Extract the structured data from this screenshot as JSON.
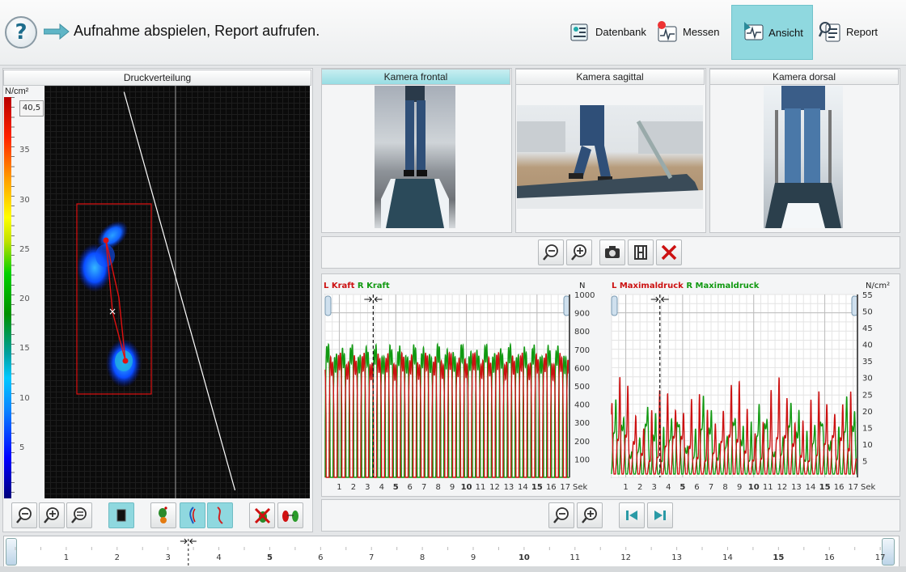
{
  "header": {
    "help_icon": "?",
    "instruction": "Aufnahme abspielen, Report aufrufen.",
    "nav": [
      {
        "label": "Datenbank",
        "icon": "database-icon"
      },
      {
        "label": "Messen",
        "icon": "measure-icon"
      },
      {
        "label": "Ansicht",
        "icon": "view-icon",
        "active": true
      },
      {
        "label": "Report",
        "icon": "report-icon"
      }
    ]
  },
  "pressure": {
    "title": "Druckverteilung",
    "unit": "N/cm²",
    "max_value": "40,5",
    "scale_labels": [
      "35",
      "30",
      "25",
      "20",
      "15",
      "10",
      "5"
    ]
  },
  "cameras": [
    {
      "title": "Kamera frontal",
      "selected": true
    },
    {
      "title": "Kamera sagittal",
      "selected": false
    },
    {
      "title": "Kamera dorsal",
      "selected": false
    }
  ],
  "charts_labels": {
    "force_left": "L Kraft",
    "force_right": "R Kraft",
    "force_unit": "N",
    "pressure_left": "L Maximaldruck",
    "pressure_right": "R Maximaldruck",
    "pressure_unit": "N/cm²",
    "time_unit": "Sek"
  },
  "chart_data": [
    {
      "type": "line",
      "series": [
        {
          "name": "L Kraft",
          "color": "#cc1111"
        },
        {
          "name": "R Kraft",
          "color": "#119911"
        }
      ],
      "x_ticks": [
        "1",
        "2",
        "3",
        "4",
        "5",
        "6",
        "7",
        "8",
        "9",
        "10",
        "11",
        "12",
        "13",
        "14",
        "15",
        "16",
        "17"
      ],
      "y_ticks": [
        "100",
        "200",
        "300",
        "400",
        "500",
        "600",
        "700",
        "800",
        "900",
        "1000"
      ],
      "xlim": [
        0,
        17.3
      ],
      "ylim": [
        0,
        1000
      ],
      "cursor_x": 3.4,
      "ylabel": "N",
      "xlabel": "Sek"
    },
    {
      "type": "line",
      "series": [
        {
          "name": "L Maximaldruck",
          "color": "#cc1111"
        },
        {
          "name": "R Maximaldruck",
          "color": "#119911"
        }
      ],
      "x_ticks": [
        "1",
        "2",
        "3",
        "4",
        "5",
        "6",
        "7",
        "8",
        "9",
        "10",
        "11",
        "12",
        "13",
        "14",
        "15",
        "16",
        "17"
      ],
      "y_ticks": [
        "5",
        "10",
        "15",
        "20",
        "25",
        "30",
        "35",
        "40",
        "45",
        "50",
        "55"
      ],
      "xlim": [
        0,
        17.3
      ],
      "ylim": [
        0,
        55
      ],
      "cursor_x": 3.4,
      "ylabel": "N/cm²",
      "xlabel": "Sek"
    }
  ],
  "timeline": {
    "ticks": [
      "1",
      "2",
      "3",
      "4",
      "5",
      "6",
      "7",
      "8",
      "9",
      "10",
      "11",
      "12",
      "13",
      "14",
      "15",
      "16",
      "17"
    ]
  },
  "colors": {
    "accent": "#8fd8df",
    "left": "#cc1111",
    "right": "#119911"
  }
}
